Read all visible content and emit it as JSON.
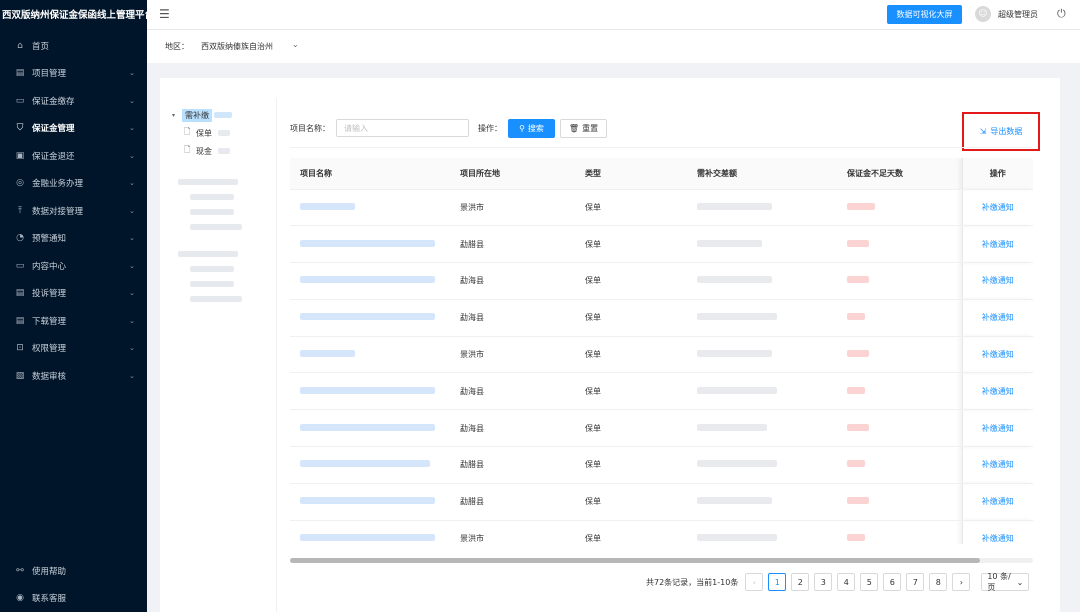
{
  "app": {
    "title": "西双版纳州保证金保函线上管理平台"
  },
  "sidebar": {
    "items": [
      {
        "label": "首页",
        "icon": "home-icon",
        "glyph": "⌂",
        "caret": "",
        "active": false
      },
      {
        "label": "项目管理",
        "icon": "calendar-icon",
        "glyph": "▤",
        "caret": "⌄",
        "active": false
      },
      {
        "label": "保证金缴存",
        "icon": "wallet-icon",
        "glyph": "▭",
        "caret": "⌄",
        "active": false
      },
      {
        "label": "保证金管理",
        "icon": "shield-icon",
        "glyph": "⛉",
        "caret": "⌄",
        "active": true
      },
      {
        "label": "保证金退还",
        "icon": "return-icon",
        "glyph": "▣",
        "caret": "⌄",
        "active": false
      },
      {
        "label": "金融业务办理",
        "icon": "finance-icon",
        "glyph": "◎",
        "caret": "⌄",
        "active": false
      },
      {
        "label": "数据对接管理",
        "icon": "upload-icon",
        "glyph": "⤒",
        "caret": "⌄",
        "active": false
      },
      {
        "label": "预警通知",
        "icon": "bell-icon",
        "glyph": "◔",
        "caret": "⌄",
        "active": false
      },
      {
        "label": "内容中心",
        "icon": "content-icon",
        "glyph": "▭",
        "caret": "⌄",
        "active": false
      },
      {
        "label": "投诉管理",
        "icon": "complaint-icon",
        "glyph": "▤",
        "caret": "⌄",
        "active": false
      },
      {
        "label": "下载管理",
        "icon": "download-icon",
        "glyph": "▤",
        "caret": "⌄",
        "active": false
      },
      {
        "label": "权限管理",
        "icon": "lock-icon",
        "glyph": "⊡",
        "caret": "⌄",
        "active": false
      },
      {
        "label": "数据审核",
        "icon": "audit-icon",
        "glyph": "▧",
        "caret": "⌄",
        "active": false
      }
    ],
    "bottom": [
      {
        "label": "使用帮助",
        "icon": "link-icon",
        "glyph": "⚯"
      },
      {
        "label": "联系客服",
        "icon": "chat-icon",
        "glyph": "◉"
      }
    ]
  },
  "header": {
    "big_screen_button": "数据可视化大屏",
    "user_name": "超级管理员",
    "collapse_glyph": "☰",
    "power_glyph": "⏻",
    "avatar_glyph": "☺"
  },
  "region": {
    "label": "地区：",
    "value": "西双版纳傣族自治州"
  },
  "tree": {
    "root": {
      "label": "需补缴"
    },
    "children": [
      {
        "label": "保单"
      },
      {
        "label": "现金"
      }
    ]
  },
  "toolbar": {
    "project_label": "项目名称：",
    "project_placeholder": "请输入",
    "op_label": "操作：",
    "search_label": "搜索",
    "reset_label": "重置",
    "export_label": "导出数据"
  },
  "table": {
    "columns": [
      "项目名称",
      "项目所在地",
      "类型",
      "需补交差额",
      "保证金不足天数",
      "操作"
    ],
    "rows": [
      {
        "location": "景洪市",
        "type": "保单",
        "action": "补缴通知"
      },
      {
        "location": "勐腊县",
        "type": "保单",
        "action": "补缴通知"
      },
      {
        "location": "勐海县",
        "type": "保单",
        "action": "补缴通知"
      },
      {
        "location": "勐海县",
        "type": "保单",
        "action": "补缴通知"
      },
      {
        "location": "景洪市",
        "type": "保单",
        "action": "补缴通知"
      },
      {
        "location": "勐海县",
        "type": "保单",
        "action": "补缴通知"
      },
      {
        "location": "勐海县",
        "type": "保单",
        "action": "补缴通知"
      },
      {
        "location": "勐腊县",
        "type": "保单",
        "action": "补缴通知"
      },
      {
        "location": "勐腊县",
        "type": "保单",
        "action": "补缴通知"
      },
      {
        "location": "景洪市",
        "type": "保单",
        "action": "补缴通知"
      }
    ]
  },
  "pagination": {
    "total_text": "共72条记录，当前1-10条",
    "pages": [
      "1",
      "2",
      "3",
      "4",
      "5",
      "6",
      "7",
      "8"
    ],
    "current": "1",
    "page_size": "10 条/页"
  }
}
